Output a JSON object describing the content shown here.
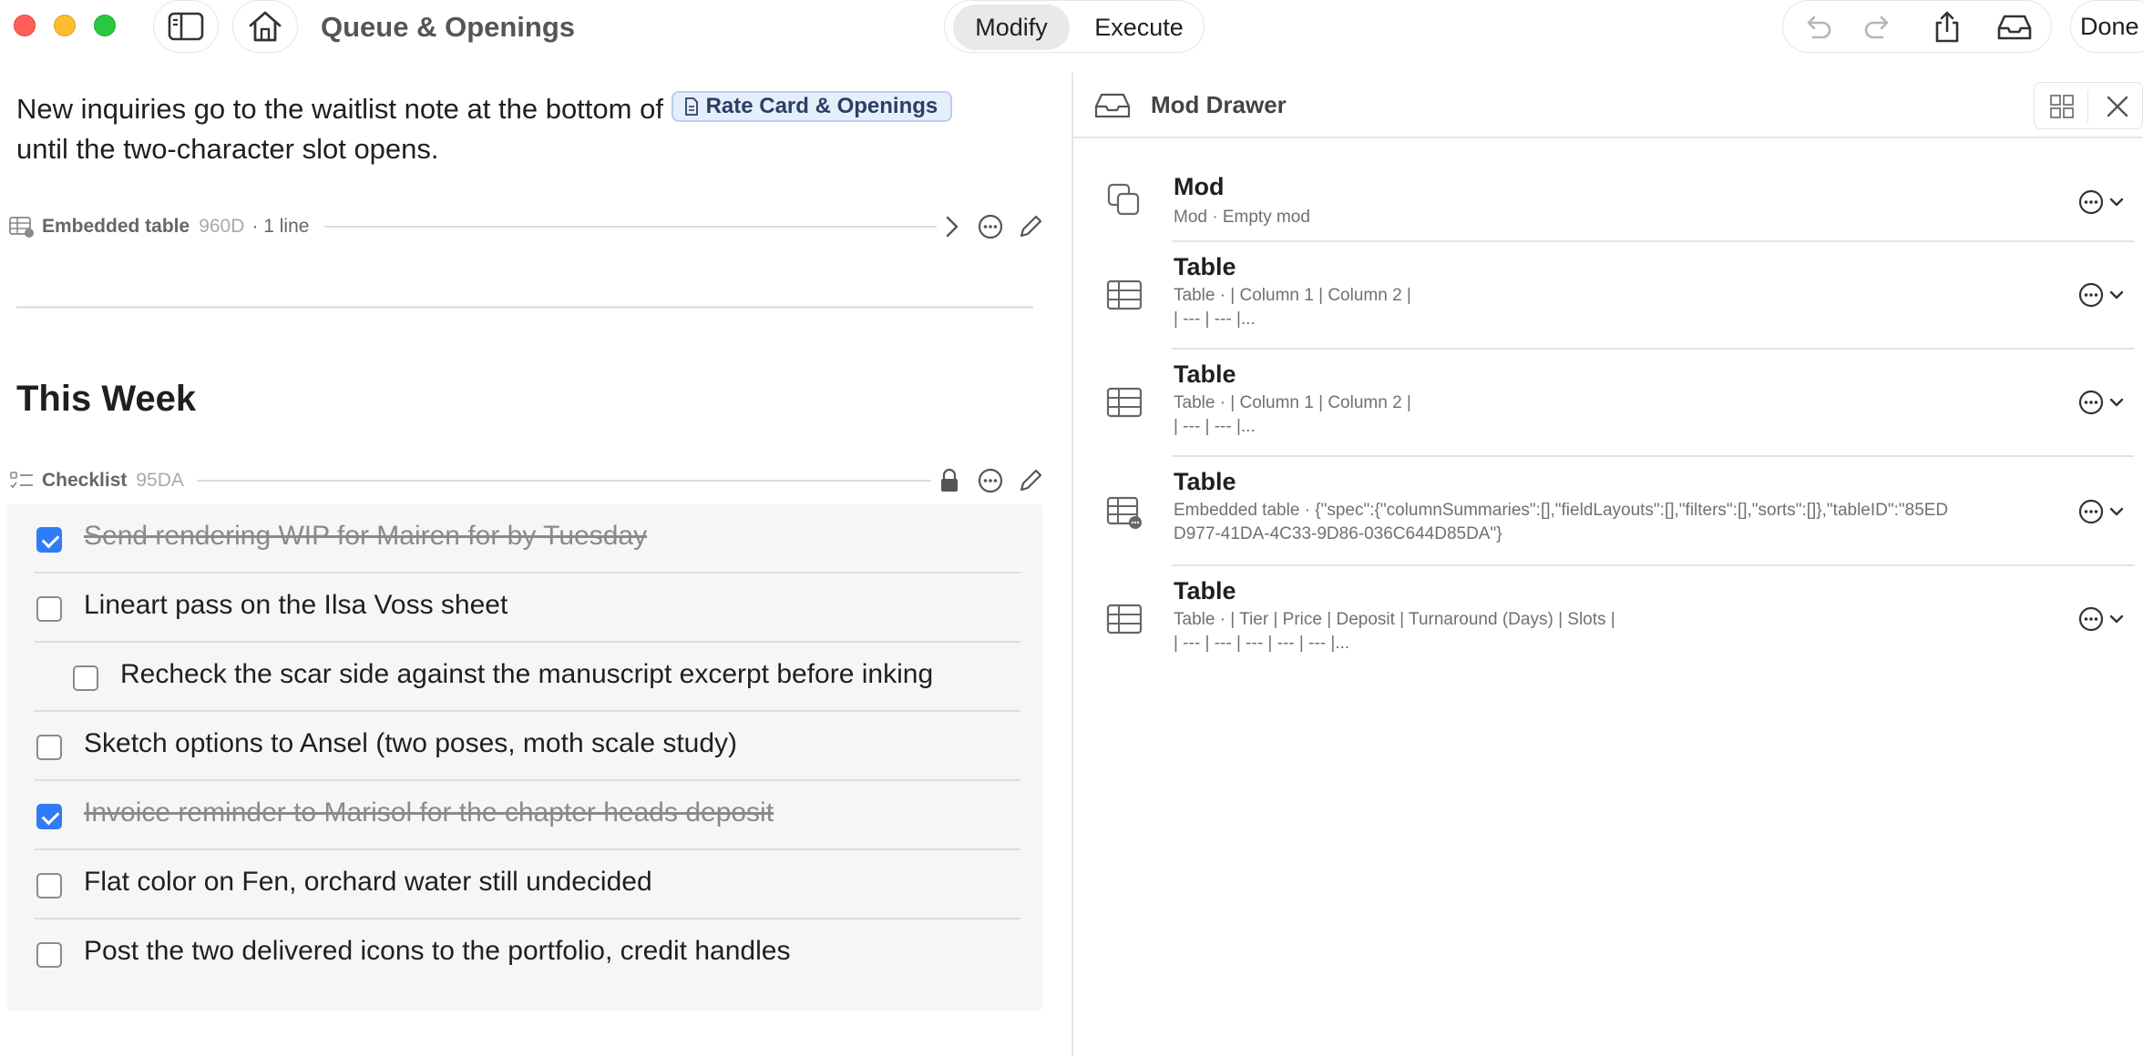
{
  "window": {
    "title": "Queue & Openings",
    "mode_tabs": [
      {
        "label": "Modify",
        "selected": true
      },
      {
        "label": "Execute",
        "selected": false
      }
    ],
    "done_label": "Done"
  },
  "icons": {
    "sidebar": "sidebar-icon",
    "home": "home-icon",
    "undo": "undo-icon",
    "redo": "redo-icon",
    "share": "share-icon",
    "tray": "tray-icon",
    "grid": "grid-icon",
    "close": "close-icon",
    "more": "ellipsis-circle-icon",
    "chevron": "chevron-down-icon",
    "pencil": "pencil-icon",
    "lock": "lock-icon",
    "chevron_right": "chevron-right-icon"
  },
  "note": {
    "paragraph_before": "New inquiries go to the waitlist note at the bottom of ",
    "link_label": "Rate Card & Openings",
    "paragraph_after": "until the two-character slot opens.",
    "embedded_block": {
      "type": "Embedded table",
      "id": "960D",
      "meta": "· 1 line"
    },
    "heading": "This Week",
    "checklist_block": {
      "type": "Checklist",
      "id": "95DA"
    },
    "checklist": [
      {
        "text": "Send rendering WIP for Mairen for by Tuesday",
        "checked": true,
        "indent": 0
      },
      {
        "text": "Lineart pass on the Ilsa Voss sheet",
        "checked": false,
        "indent": 0
      },
      {
        "text": "Recheck the scar side against the manuscript excerpt before inking",
        "checked": false,
        "indent": 1
      },
      {
        "text": "Sketch options to Ansel (two poses, moth scale study)",
        "checked": false,
        "indent": 0
      },
      {
        "text": "Invoice reminder to Marisol for the chapter heads deposit",
        "checked": true,
        "indent": 0
      },
      {
        "text": "Flat color on Fen, orchard water still undecided",
        "checked": false,
        "indent": 0
      },
      {
        "text": "Post the two delivered icons to the portfolio, credit handles",
        "checked": false,
        "indent": 0
      }
    ]
  },
  "drawer": {
    "title": "Mod Drawer",
    "items": [
      {
        "name": "Mod",
        "icon": "copy-icon",
        "desc": "Mod · Empty mod"
      },
      {
        "name": "Table",
        "icon": "table-icon",
        "desc": "Table · | Column 1 | Column 2 |\n| --- | --- |..."
      },
      {
        "name": "Table",
        "icon": "table-icon",
        "desc": "Table · | Column 1 | Column 2 |\n| --- | --- |..."
      },
      {
        "name": "Table",
        "icon": "embedded-table-icon",
        "desc": "Embedded table · {\"spec\":{\"columnSummaries\":[],\"fieldLayouts\":[],\"filters\":[],\"sorts\":[]},\"tableID\":\"85EDD977-41DA-4C33-9D86-036C644D85DA\"}"
      },
      {
        "name": "Table",
        "icon": "table-icon",
        "desc": "Table · | Tier | Price | Deposit | Turnaround (Days) | Slots |\n| --- | --- | --- | --- | --- |..."
      }
    ]
  }
}
